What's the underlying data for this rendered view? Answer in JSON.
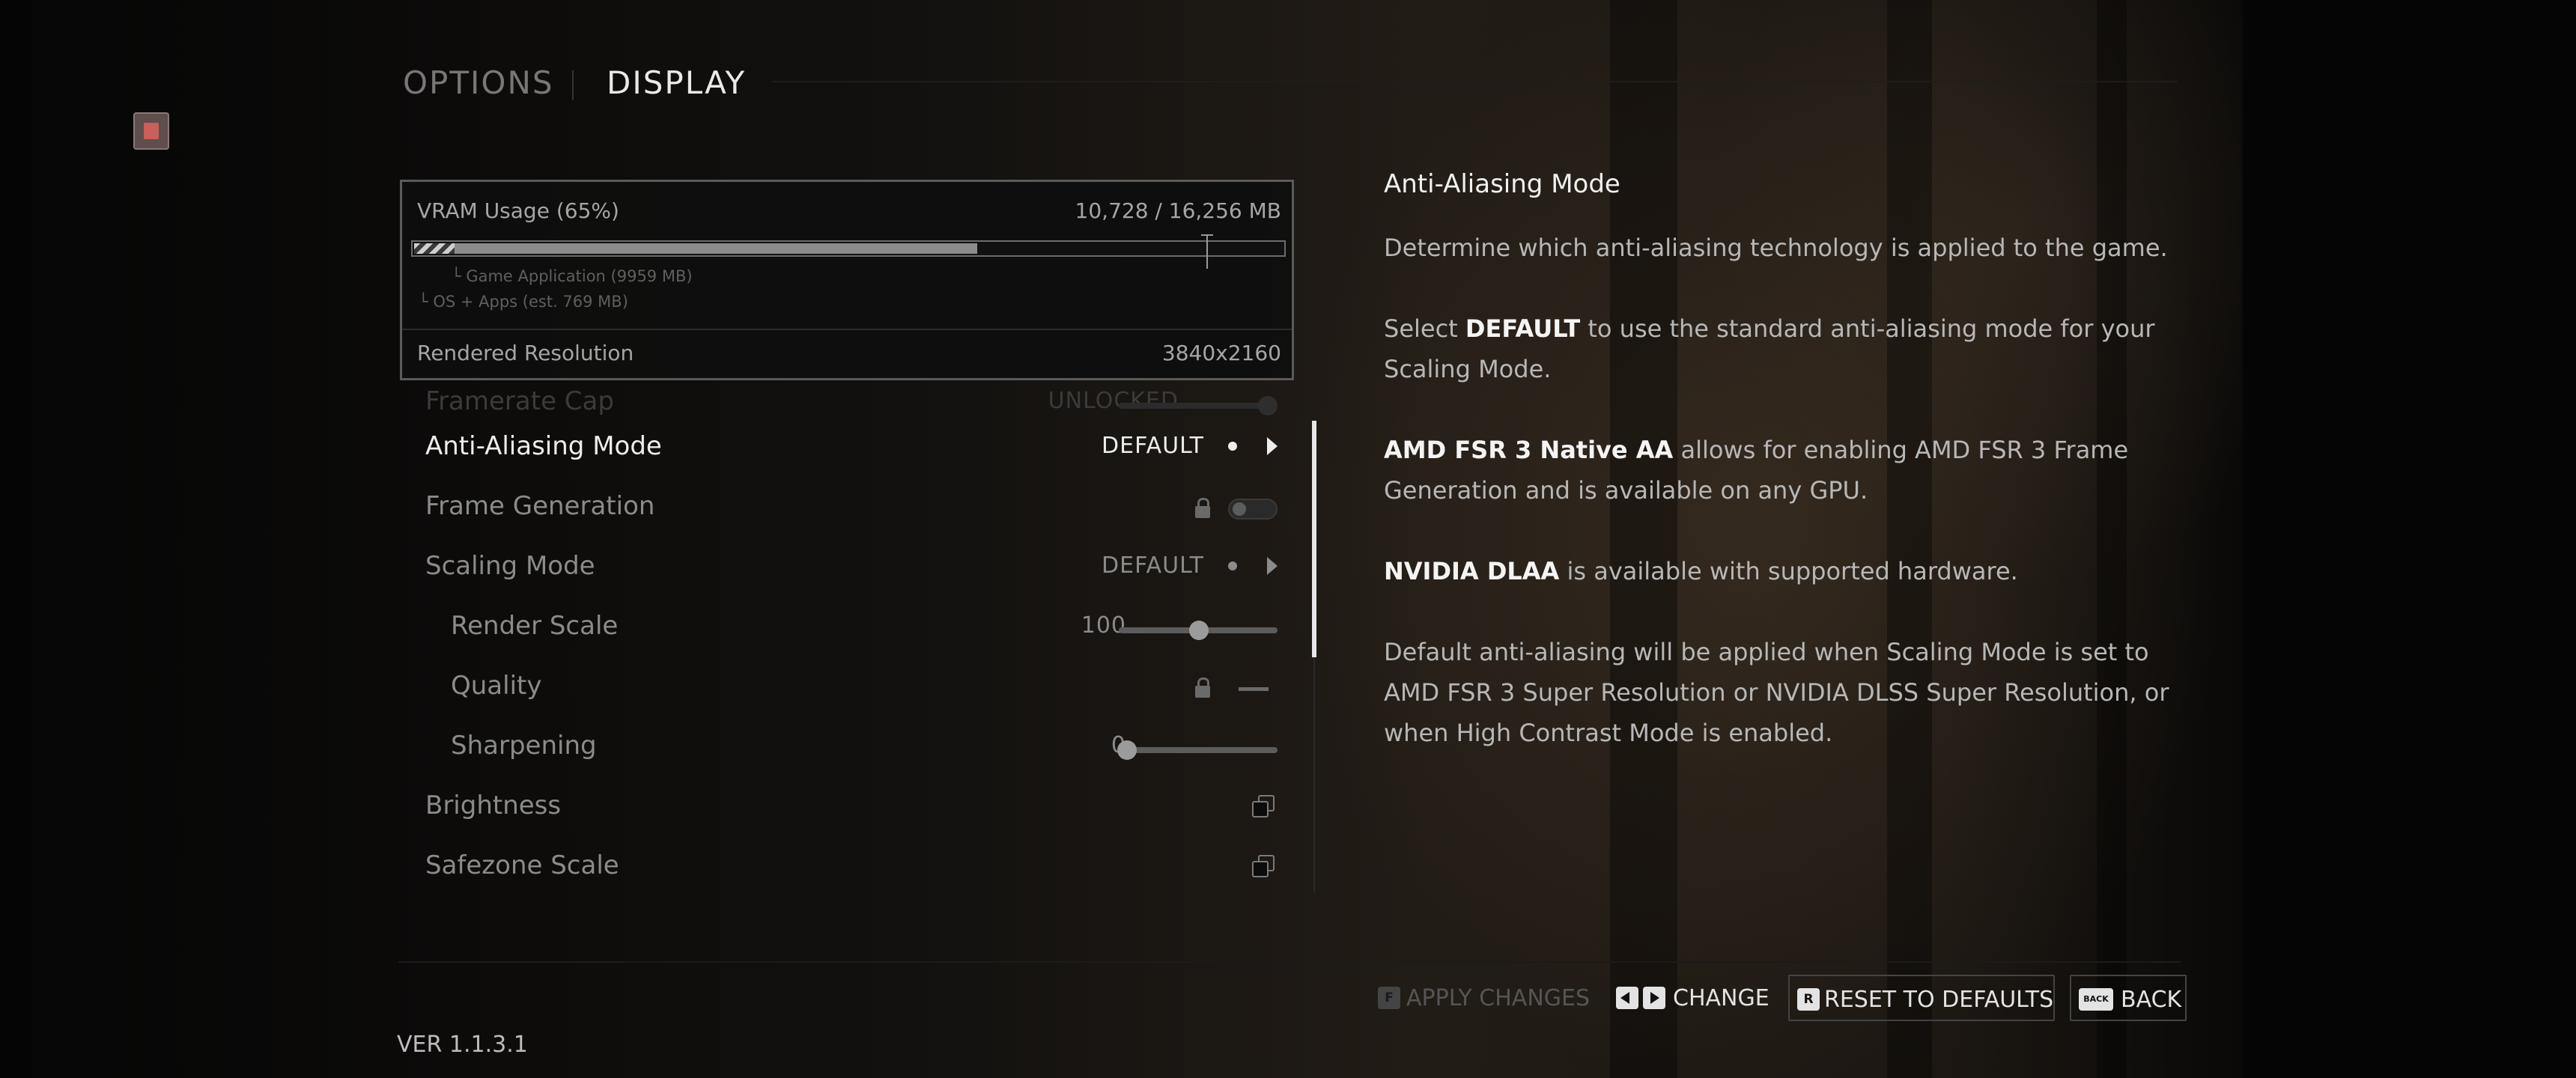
{
  "header": {
    "tab_options": "OPTIONS",
    "tab_display": "DISPLAY"
  },
  "vram": {
    "title": "VRAM Usage (65%)",
    "value": "10,728 / 16,256 MB",
    "game_application": "Game Application (9959 MB)",
    "os_apps": "OS + Apps (est. 769 MB)",
    "used_fraction": 0.65,
    "rendered_resolution_label": "Rendered Resolution",
    "rendered_resolution_value": "3840x2160"
  },
  "settings": {
    "framerate_cap": {
      "label": "Framerate Cap",
      "value": "UNLOCKED"
    },
    "anti_aliasing": {
      "label": "Anti-Aliasing Mode",
      "value": "DEFAULT"
    },
    "frame_generation": {
      "label": "Frame Generation",
      "value": "off"
    },
    "scaling_mode": {
      "label": "Scaling Mode",
      "value": "DEFAULT"
    },
    "render_scale": {
      "label": "Render Scale",
      "value": "100"
    },
    "quality": {
      "label": "Quality"
    },
    "sharpening": {
      "label": "Sharpening",
      "value": "0"
    },
    "brightness": {
      "label": "Brightness"
    },
    "safezone_scale": {
      "label": "Safezone Scale"
    }
  },
  "description": {
    "heading": "Anti-Aliasing Mode",
    "p1": "Determine which anti-aliasing technology is applied to the game.",
    "p2_pre": "Select ",
    "p2_bold": "DEFAULT",
    "p2_post": " to use the standard anti-aliasing mode for your Scaling Mode.",
    "p3_bold": "AMD FSR 3 Native AA",
    "p3_post": " allows for enabling AMD FSR 3 Frame Generation and is available on any GPU.",
    "p4_bold": "NVIDIA DLAA",
    "p4_post": " is available with supported hardware.",
    "p5": "Default anti-aliasing will be applied when Scaling Mode is set to AMD FSR 3 Super Resolution or NVIDIA DLSS Super Resolution, or when High Contrast Mode is enabled."
  },
  "footer": {
    "apply_key": "F",
    "apply_label": "APPLY CHANGES",
    "change_label": "CHANGE",
    "reset_key": "R",
    "reset_label": "RESET TO DEFAULTS",
    "back_key": "BACK",
    "back_label": "BACK"
  },
  "version": "VER 1.1.3.1",
  "icons": {
    "app": "app-logo-icon",
    "option_dot": "dot-icon",
    "option_arrow": "triangle-right-icon",
    "locked": "lock-icon",
    "open_submenu": "copy-icon",
    "change_keys": "left-right-arrow-keys-icon"
  }
}
